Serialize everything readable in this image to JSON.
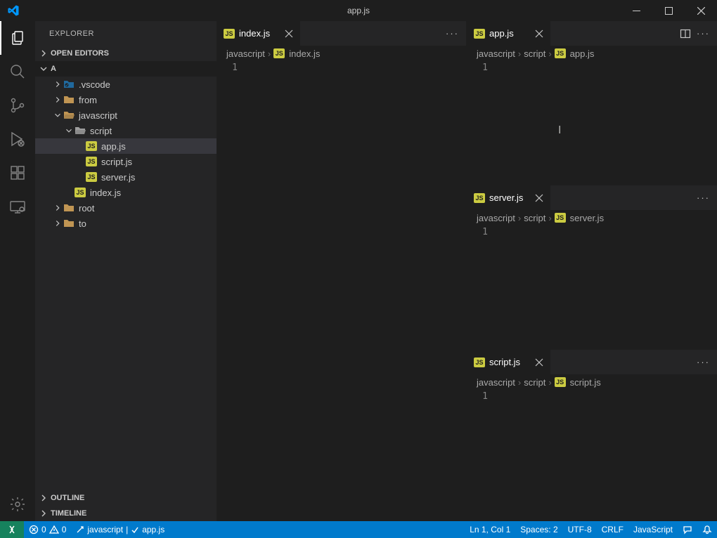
{
  "title": "app.js",
  "sidebar": {
    "title": "EXPLORER",
    "open_editors": "OPEN EDITORS",
    "workspace": "A",
    "outline": "OUTLINE",
    "timeline": "TIMELINE",
    "tree": {
      "vscode": ".vscode",
      "from": "from",
      "javascript": "javascript",
      "script": "script",
      "appjs": "app.js",
      "scriptjs": "script.js",
      "serverjs": "server.js",
      "indexjs": "index.js",
      "root": "root",
      "to": "to"
    }
  },
  "js_badge": "JS",
  "editor": {
    "left": {
      "tab": "index.js",
      "crumb1": "javascript",
      "crumb_file": "index.js",
      "line": "1"
    },
    "right1": {
      "tab": "app.js",
      "crumb1": "javascript",
      "crumb2": "script",
      "crumb_file": "app.js",
      "line": "1"
    },
    "right2": {
      "tab": "server.js",
      "crumb1": "javascript",
      "crumb2": "script",
      "crumb_file": "server.js",
      "line": "1"
    },
    "right3": {
      "tab": "script.js",
      "crumb1": "javascript",
      "crumb2": "script",
      "crumb_file": "script.js",
      "line": "1"
    }
  },
  "status": {
    "errors": "0",
    "warnings": "0",
    "git_branch": "javascript",
    "git_file": "app.js",
    "lncol": "Ln 1, Col 1",
    "spaces": "Spaces: 2",
    "encoding": "UTF-8",
    "eol": "CRLF",
    "lang": "JavaScript"
  }
}
